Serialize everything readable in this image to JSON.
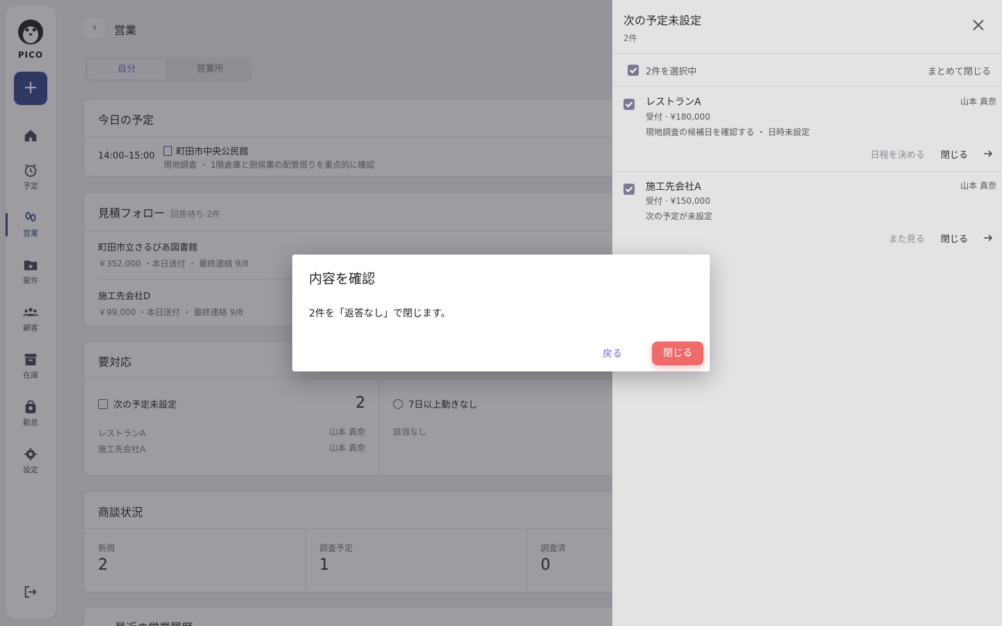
{
  "app": {
    "logo_text": "PICO"
  },
  "sidebar": {
    "items": [
      {
        "label": "",
        "icon": "home-icon"
      },
      {
        "label": "予定",
        "icon": "alarm-icon"
      },
      {
        "label": "営業",
        "icon": "footprints-icon",
        "active": true
      },
      {
        "label": "案件",
        "icon": "folder-star-icon"
      },
      {
        "label": "顧客",
        "icon": "people-icon"
      },
      {
        "label": "在庫",
        "icon": "archive-icon"
      },
      {
        "label": "勤怠",
        "icon": "bag-icon"
      },
      {
        "label": "設定",
        "icon": "gear-icon"
      }
    ]
  },
  "main": {
    "title": "営業",
    "tabs": [
      "自分",
      "営業所"
    ],
    "today": {
      "title": "今日の予定",
      "time": "14:00–15:00",
      "place": "町田市中央公民館",
      "detail": "現地調査 ・ 1階倉庫と厨房裏の配管周りを重点的に確認"
    },
    "estimate": {
      "title": "見積フォロー",
      "sub": "回答待ち 2件",
      "rows": [
        {
          "name": "町田市立さるびあ図書館",
          "meta": "￥352,000 ・本日送付 ・ 最終連絡 9/8"
        },
        {
          "name": "施工先会社D",
          "meta": "￥99,000 ・本日送付 ・ 最終連絡 9/8"
        }
      ]
    },
    "attention": {
      "title": "要対応",
      "left": {
        "title": "次の予定未設定",
        "count": "2",
        "rows": [
          {
            "name": "レストランA",
            "owner": "山本 真奈"
          },
          {
            "name": "施工先会社A",
            "owner": "山本 真奈"
          }
        ]
      },
      "right": {
        "title": "7日以上動きなし",
        "empty": "該当なし"
      }
    },
    "deals": {
      "title": "商談状況",
      "stats": [
        {
          "label": "新規",
          "value": "2"
        },
        {
          "label": "調査予定",
          "value": "1"
        },
        {
          "label": "調査済",
          "value": "0"
        }
      ]
    },
    "history": {
      "title": "最近の営業履歴"
    }
  },
  "drawer": {
    "title": "次の予定未設定",
    "count": "2件",
    "select_all": "2件を選択中",
    "bulk_close": "まとめて閉じる",
    "items": [
      {
        "name": "レストランA",
        "owner": "山本 真奈",
        "line1": "受付 · ¥180,000",
        "line2": "現地調査の候補日を確認する ・ 日時未設定",
        "action_primary": "日程を決める",
        "action_close": "閉じる"
      },
      {
        "name": "施工先会社A",
        "owner": "山本 真奈",
        "line1": "受付 · ¥150,000",
        "line2": "次の予定が未設定",
        "action_primary": "また見る",
        "action_close": "閉じる"
      }
    ]
  },
  "modal": {
    "title": "内容を確認",
    "body": "2件を「返答なし」で閉じます。",
    "back": "戻る",
    "confirm": "閉じる"
  },
  "colors": {
    "accent": "#3d4a8c",
    "link": "#6a6ad0",
    "danger": "#ef6a6a"
  }
}
